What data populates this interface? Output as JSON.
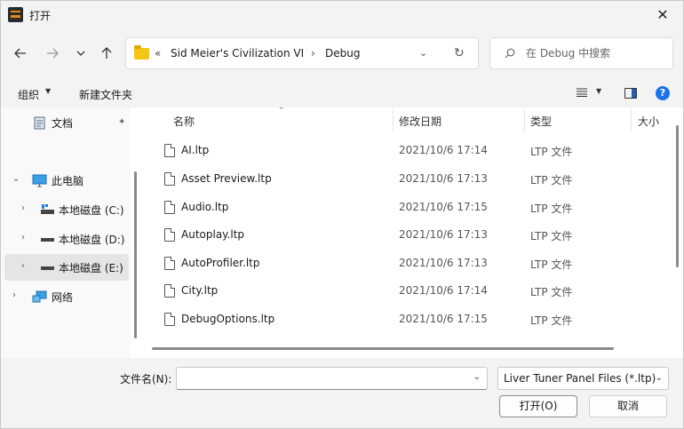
{
  "window": {
    "title": "打开",
    "close_glyph": "✕"
  },
  "nav": {
    "back_icon": "arrow-left-icon",
    "forward_icon": "arrow-right-icon",
    "recent_icon": "chevron-down-icon",
    "up_icon": "arrow-up-icon"
  },
  "address": {
    "overflow": "«",
    "crumbs": [
      "Sid Meier's Civilization VI",
      "Debug"
    ],
    "separator": "›",
    "dropdown_glyph": "⌄",
    "refresh_glyph": "↻"
  },
  "search": {
    "placeholder": "在 Debug 中搜索"
  },
  "toolbar": {
    "organize_label": "组织",
    "caret": "▼",
    "new_folder_label": "新建文件夹"
  },
  "sidebar": {
    "items": [
      {
        "label": "文档",
        "icon": "documents-icon",
        "pinned": true
      },
      {
        "label": "此电脑",
        "icon": "computer-icon",
        "expanded": true
      },
      {
        "label": "本地磁盘 (C:)",
        "icon": "drive-c-icon"
      },
      {
        "label": "本地磁盘 (D:)",
        "icon": "drive-icon"
      },
      {
        "label": "本地磁盘 (E:)",
        "icon": "drive-icon",
        "selected": true
      },
      {
        "label": "网络",
        "icon": "network-icon"
      }
    ],
    "chevron_right": "›",
    "chevron_down": "⌄",
    "pin_glyph": "📌"
  },
  "files": {
    "columns": [
      "名称",
      "修改日期",
      "类型",
      "大小"
    ],
    "sort_glyph": "⌃",
    "rows": [
      {
        "name": "AI.ltp",
        "date": "2021/10/6 17:14",
        "type": "LTP 文件"
      },
      {
        "name": "Asset Preview.ltp",
        "date": "2021/10/6 17:13",
        "type": "LTP 文件"
      },
      {
        "name": "Audio.ltp",
        "date": "2021/10/6 17:15",
        "type": "LTP 文件"
      },
      {
        "name": "Autoplay.ltp",
        "date": "2021/10/6 17:13",
        "type": "LTP 文件"
      },
      {
        "name": "AutoProfiler.ltp",
        "date": "2021/10/6 17:13",
        "type": "LTP 文件"
      },
      {
        "name": "City.ltp",
        "date": "2021/10/6 17:14",
        "type": "LTP 文件"
      },
      {
        "name": "DebugOptions.ltp",
        "date": "2021/10/6 17:15",
        "type": "LTP 文件"
      }
    ]
  },
  "bottom": {
    "filename_label": "文件名(N):",
    "filename_value": "",
    "filter_value": "Liver Tuner Panel Files (*.ltp)",
    "caret": "⌄",
    "open_label": "打开(O)",
    "cancel_label": "取消"
  },
  "colors": {
    "accent": "#1a73e8",
    "folder": "#f5c518",
    "selected_bg": "#e5e5e5"
  }
}
